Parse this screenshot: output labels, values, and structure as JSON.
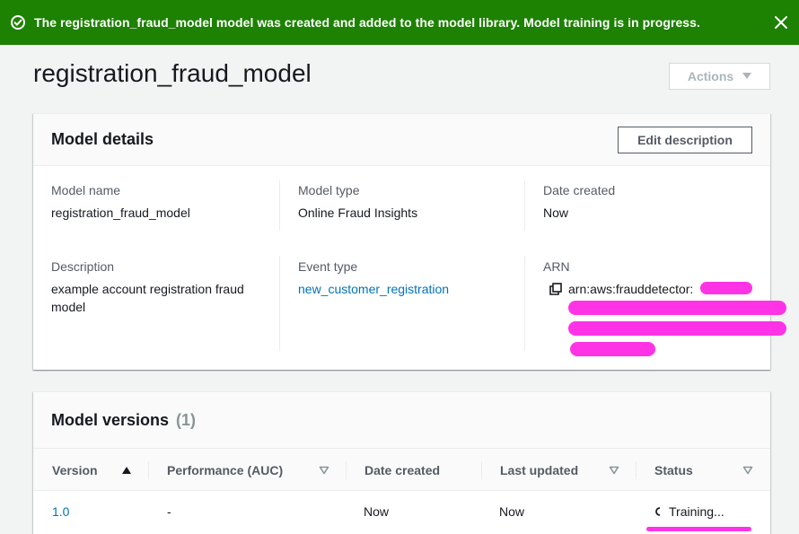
{
  "flash": {
    "message": "The registration_fraud_model model was created and added to the model library. Model training is in progress.",
    "color": "#1d8102"
  },
  "header": {
    "title": "registration_fraud_model",
    "actions_label": "Actions"
  },
  "details": {
    "title": "Model details",
    "edit_label": "Edit description",
    "fields": {
      "model_name": {
        "label": "Model name",
        "value": "registration_fraud_model"
      },
      "model_type": {
        "label": "Model type",
        "value": "Online Fraud Insights"
      },
      "date_created": {
        "label": "Date created",
        "value": "Now"
      },
      "description": {
        "label": "Description",
        "value": "example account registration fraud model"
      },
      "event_type": {
        "label": "Event type",
        "value": "new_customer_registration"
      },
      "arn": {
        "label": "ARN",
        "value": "arn:aws:frauddetector:"
      }
    }
  },
  "versions": {
    "title": "Model versions",
    "count": "(1)",
    "columns": [
      "Version",
      "Performance (AUC)",
      "Date created",
      "Last updated",
      "Status"
    ],
    "rows": [
      {
        "version": "1.0",
        "performance": "-",
        "date_created": "Now",
        "last_updated": "Now",
        "status": "Training..."
      }
    ]
  },
  "colors": {
    "link": "#0073bb",
    "redaction": "#ff33e6",
    "success": "#1d8102"
  }
}
